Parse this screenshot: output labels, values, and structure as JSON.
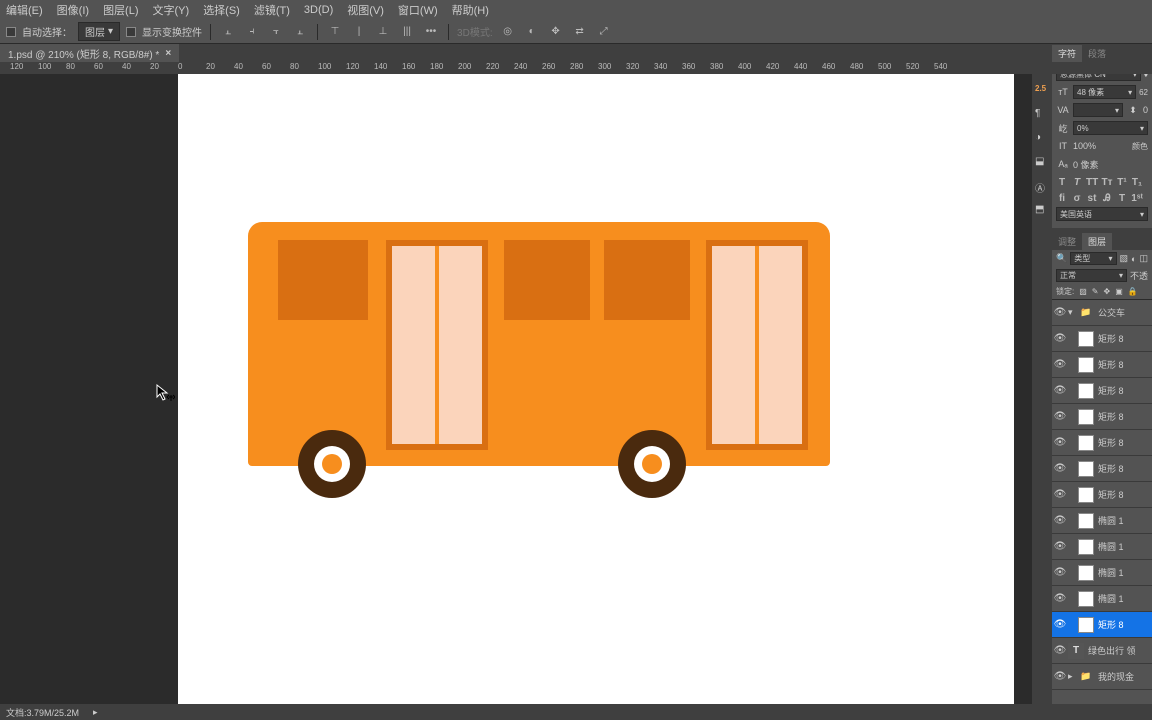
{
  "menu": {
    "items": [
      "编辑(E)",
      "图像(I)",
      "图层(L)",
      "文字(Y)",
      "选择(S)",
      "滤镜(T)",
      "3D(D)",
      "视图(V)",
      "窗口(W)",
      "帮助(H)"
    ]
  },
  "optbar": {
    "auto_select": "自动选择：",
    "layer_dropdown": "图层",
    "transform_controls": "显示变换控件",
    "mode3d_label": "3D模式:"
  },
  "tab": {
    "title": "1.psd @ 210% (矩形 8, RGB/8#) *"
  },
  "ruler": {
    "ticks": [
      "120",
      "100",
      "80",
      "60",
      "40",
      "20",
      "0",
      "20",
      "40",
      "60",
      "80",
      "100",
      "120",
      "140",
      "160",
      "180",
      "200",
      "220",
      "240",
      "260",
      "280",
      "300",
      "320",
      "340",
      "360",
      "380",
      "400",
      "420",
      "440",
      "460",
      "480",
      "500",
      "520",
      "540"
    ]
  },
  "panels": {
    "char_tab": "字符",
    "para_tab": "段落",
    "font": "思源黑体 CN",
    "size": "48 像素",
    "size_val": "62",
    "va": "VA",
    "metric": "0",
    "percent": "0%",
    "aa": "100%",
    "baseline": "0 像素",
    "stroke_mark": "2.5",
    "lang": "美国英语",
    "color_label": "颜色",
    "adjust_tab": "调整",
    "layers_tab": "图层",
    "kind": "类型",
    "blend": "正常",
    "opacity_label": "不透",
    "lock_label": "锁定:"
  },
  "layers": [
    {
      "name": "公交车",
      "type": "folder",
      "indent": 0,
      "arrow": "▾"
    },
    {
      "name": "矩形 8",
      "type": "shape",
      "indent": 1
    },
    {
      "name": "矩形 8",
      "type": "shape",
      "indent": 1
    },
    {
      "name": "矩形 8",
      "type": "shape",
      "indent": 1
    },
    {
      "name": "矩形 8",
      "type": "shape",
      "indent": 1
    },
    {
      "name": "矩形 8",
      "type": "shape",
      "indent": 1
    },
    {
      "name": "矩形 8",
      "type": "shape",
      "indent": 1
    },
    {
      "name": "矩形 8",
      "type": "shape",
      "indent": 1
    },
    {
      "name": "椭圆 1",
      "type": "shape",
      "indent": 1
    },
    {
      "name": "椭圆 1",
      "type": "shape",
      "indent": 1
    },
    {
      "name": "椭圆 1",
      "type": "shape",
      "indent": 1
    },
    {
      "name": "椭圆 1",
      "type": "shape",
      "indent": 1
    },
    {
      "name": "矩形 8",
      "type": "shape",
      "indent": 1,
      "sel": true
    },
    {
      "name": "绿色出行 领",
      "type": "text",
      "indent": 0
    },
    {
      "name": "我的现金",
      "type": "folder",
      "indent": 0,
      "arrow": "▸"
    }
  ],
  "status": {
    "doc": "文档:3.79M/25.2M",
    "arrow": "▸"
  }
}
